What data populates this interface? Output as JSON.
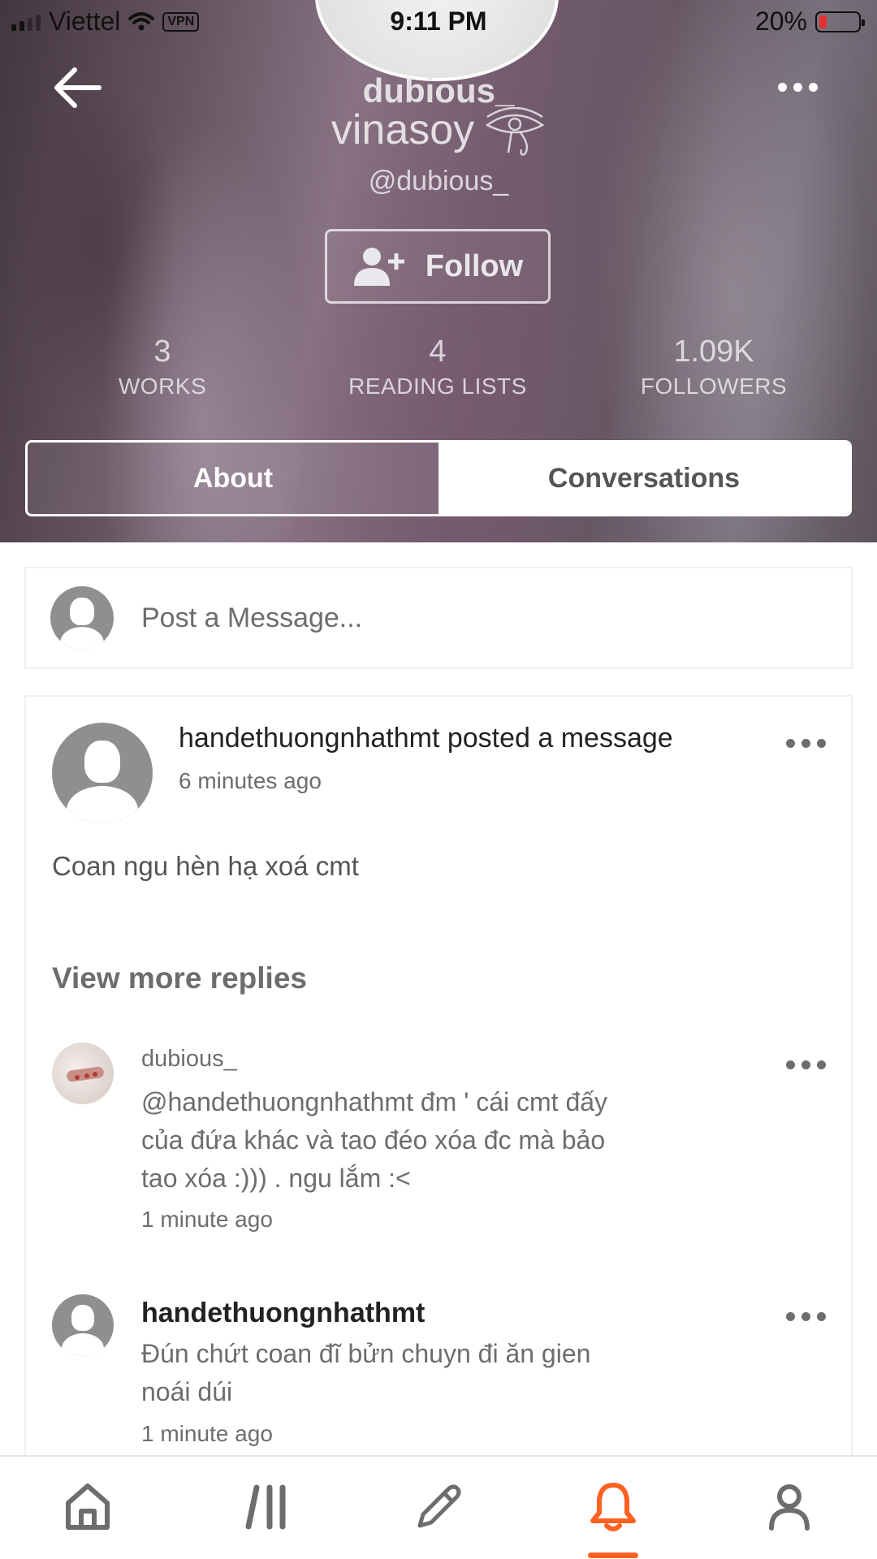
{
  "status_bar": {
    "carrier": "Viettel",
    "vpn": "VPN",
    "time": "9:11 PM",
    "battery": "20%"
  },
  "profile": {
    "username_top": "dubious_",
    "display_name": "vinasoy",
    "handle": "@dubious_",
    "follow_label": "Follow",
    "stats": [
      {
        "value": "3",
        "label": "WORKS"
      },
      {
        "value": "4",
        "label": "READING LISTS"
      },
      {
        "value": "1.09K",
        "label": "FOLLOWERS"
      }
    ],
    "tabs": [
      {
        "label": "About",
        "active": false
      },
      {
        "label": "Conversations",
        "active": true
      }
    ]
  },
  "composer": {
    "placeholder": "Post a Message..."
  },
  "message": {
    "title": "handethuongnhathmt posted a message",
    "time": "6 minutes ago",
    "text": "Coan ngu hèn hạ xoá cmt",
    "view_more": "View more replies"
  },
  "replies": [
    {
      "name": "dubious_",
      "lines": [
        "@handethuongnhathmt  đm ' cái cmt đấy",
        "của đứa khác và tao đéo xóa đc mà bảo",
        "tao xóa :))) . ngu lắm :<"
      ],
      "time": "1 minute ago"
    },
    {
      "name": "handethuongnhathmt",
      "lines": [
        "Đún chứt coan đĩ bửn chuyn đi ăn gien",
        "noái dúi"
      ],
      "time": "1 minute ago"
    }
  ],
  "nav": {
    "items": [
      {
        "icon": "home-icon"
      },
      {
        "icon": "library-icon"
      },
      {
        "icon": "pencil-icon"
      },
      {
        "icon": "bell-icon",
        "active": true
      },
      {
        "icon": "profile-icon"
      }
    ],
    "accent": "#ff6122"
  },
  "colors": {
    "text_dark": "#222222",
    "text_gray": "#6d6d6d",
    "card_border": "#efefef"
  }
}
